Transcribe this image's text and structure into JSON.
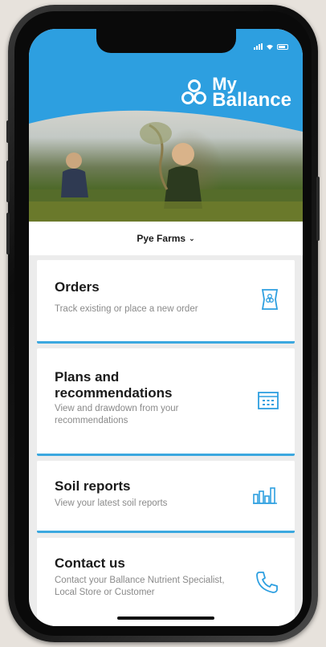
{
  "app": {
    "logo_line1": "My",
    "logo_line2": "Ballance"
  },
  "farm_selector": {
    "name": "Pye Farms"
  },
  "cards": [
    {
      "title": "Orders",
      "desc": "Track existing or place a new order",
      "icon": "fertiliser-bag-icon"
    },
    {
      "title": "Plans and recommendations",
      "desc": "View and drawdown from your recommendations",
      "icon": "calendar-icon"
    },
    {
      "title": "Soil reports",
      "desc": "View your latest soil reports",
      "icon": "bar-chart-icon"
    },
    {
      "title": "Contact us",
      "desc": "Contact your Ballance Nutrient Specialist, Local Store or Customer",
      "icon": "phone-icon"
    }
  ],
  "colors": {
    "accent": "#3ca8df",
    "brand_blue": "#2d9fe0"
  }
}
